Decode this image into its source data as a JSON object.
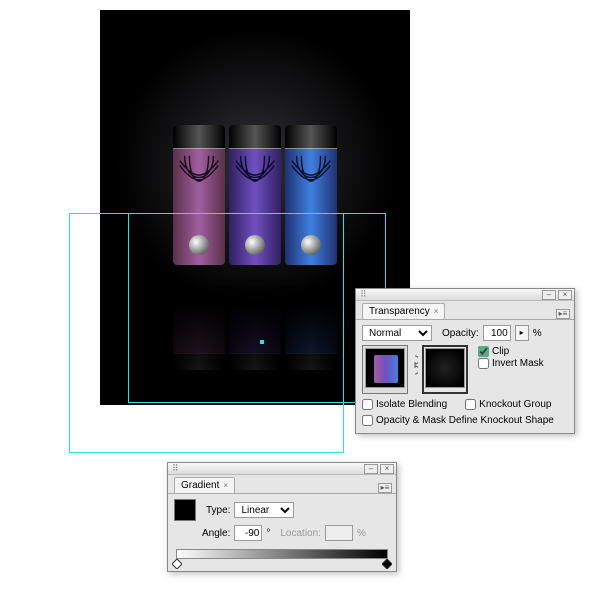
{
  "transparency": {
    "title": "Transparency",
    "blend_mode": "Normal",
    "opacity_label": "Opacity:",
    "opacity_value": "100",
    "opacity_suffix": "%",
    "clip_label": "Clip",
    "clip_checked": true,
    "invert_label": "Invert Mask",
    "invert_checked": false,
    "isolate_label": "Isolate Blending",
    "isolate_checked": false,
    "knockout_label": "Knockout Group",
    "knockout_checked": false,
    "define_label": "Opacity & Mask Define Knockout Shape",
    "define_checked": false
  },
  "gradient": {
    "title": "Gradient",
    "type_label": "Type:",
    "type_value": "Linear",
    "angle_label": "Angle:",
    "angle_value": "-90",
    "location_label": "Location:",
    "location_value": "",
    "location_suffix": "%"
  }
}
